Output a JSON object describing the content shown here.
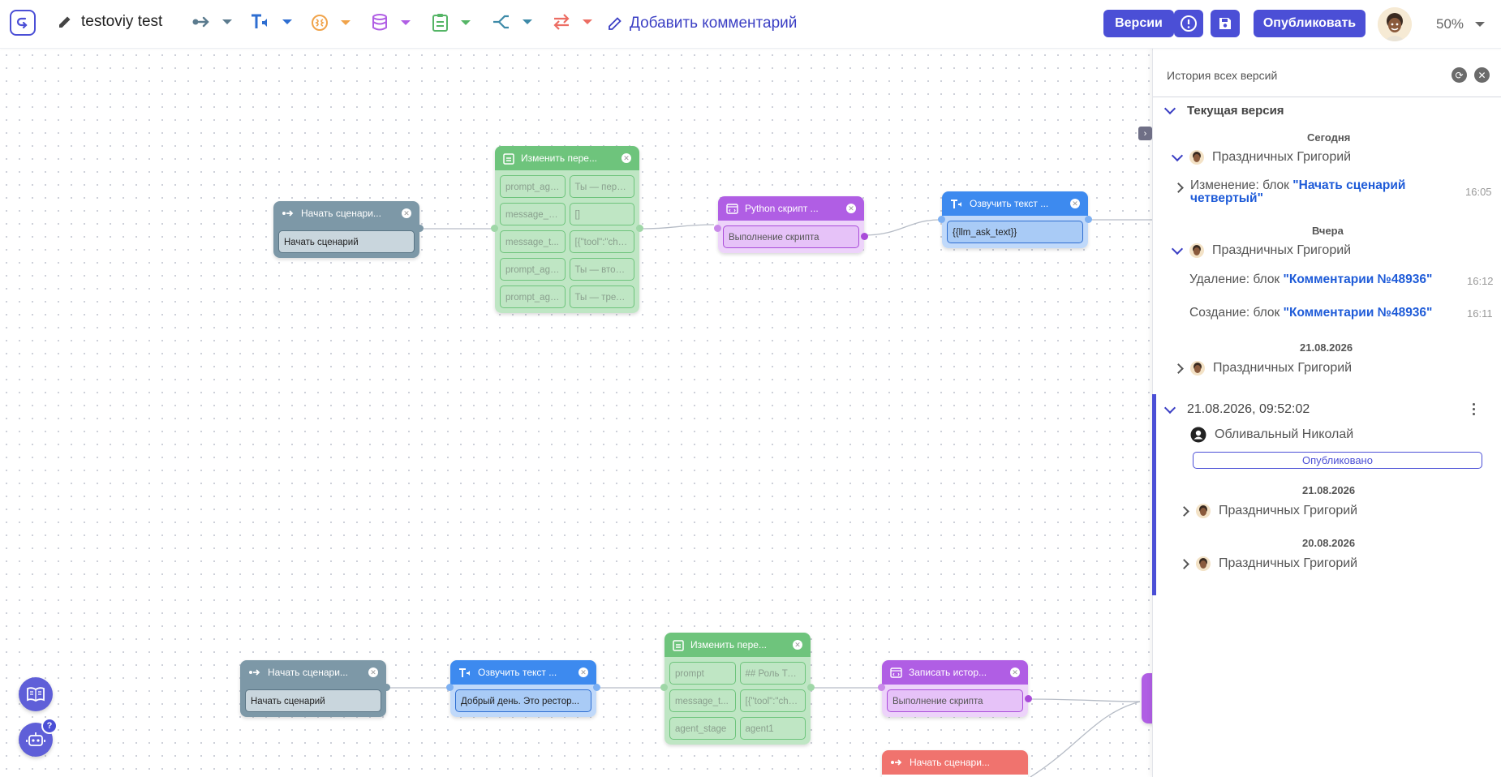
{
  "toolbar": {
    "title": "testoviy test",
    "add_comment": "Добавить комментарий",
    "versions_button": "Версии",
    "publish_button": "Опубликовать",
    "zoom": "50%"
  },
  "canvas": {
    "nodes": {
      "start1": {
        "title": "Начать сценари...",
        "field": "Начать сценарий"
      },
      "change1": {
        "title": "Изменить пере...",
        "rows": [
          [
            "prompt_age...",
            "Ты — перв..."
          ],
          [
            "message_di...",
            "[]"
          ],
          [
            "message_t...",
            "[{\"tool\":\"che..."
          ],
          [
            "prompt_age...",
            "Ты — второ..."
          ],
          [
            "prompt_age...",
            "Ты — трети..."
          ]
        ]
      },
      "python1": {
        "title": "Python скрипт ...",
        "field": "Выполнение скрипта"
      },
      "speak1": {
        "title": "Озвучить текст ...",
        "field": "{{llm_ask_text}}"
      },
      "start2": {
        "title": "Начать сценари...",
        "field": "Начать сценарий"
      },
      "speak2": {
        "title": "Озвучить текст ...",
        "field": "Добрый день. Это рестор..."
      },
      "change2": {
        "title": "Изменить пере...",
        "rows": [
          [
            "prompt",
            "## Роль Ты..."
          ],
          [
            "message_t...",
            "[{\"tool\":\"che..."
          ],
          [
            "agent_stage",
            "agent1"
          ]
        ]
      },
      "write1": {
        "title": "Записать истор...",
        "field": "Выполнение скрипта"
      },
      "start3": {
        "title": "Начать сценари..."
      }
    }
  },
  "panel": {
    "title": "История всех версий",
    "current_version": "Текущая версия",
    "groups": [
      {
        "date": "Сегодня",
        "user": "Праздничных Григорий",
        "changes": [
          {
            "prefix": "Изменение: блок",
            "target": "\"Начать сценарий четвертый\"",
            "time": "16:05"
          }
        ]
      },
      {
        "date": "Вчера",
        "user": "Праздничных Григорий",
        "changes": [
          {
            "prefix": "Удаление: блок",
            "target": "\"Комментарии №48936\"",
            "time": "16:12"
          },
          {
            "prefix": "Создание: блок",
            "target": "\"Комментарии №48936\"",
            "time": "16:11"
          }
        ]
      },
      {
        "date": "21.08.2026",
        "user": "Праздничных Григорий"
      }
    ],
    "published_version": {
      "datetime": "21.08.2026, 09:52:02",
      "author": "Обливальный Николай",
      "status": "Опубликовано",
      "groups": [
        {
          "date": "21.08.2026",
          "user": "Праздничных Григорий"
        },
        {
          "date": "20.08.2026",
          "user": "Праздничных Григорий"
        }
      ]
    }
  },
  "fab": {
    "help_badge": "?"
  },
  "colors": {
    "accent": "#4b4fd6",
    "link": "#1e5bd8"
  }
}
